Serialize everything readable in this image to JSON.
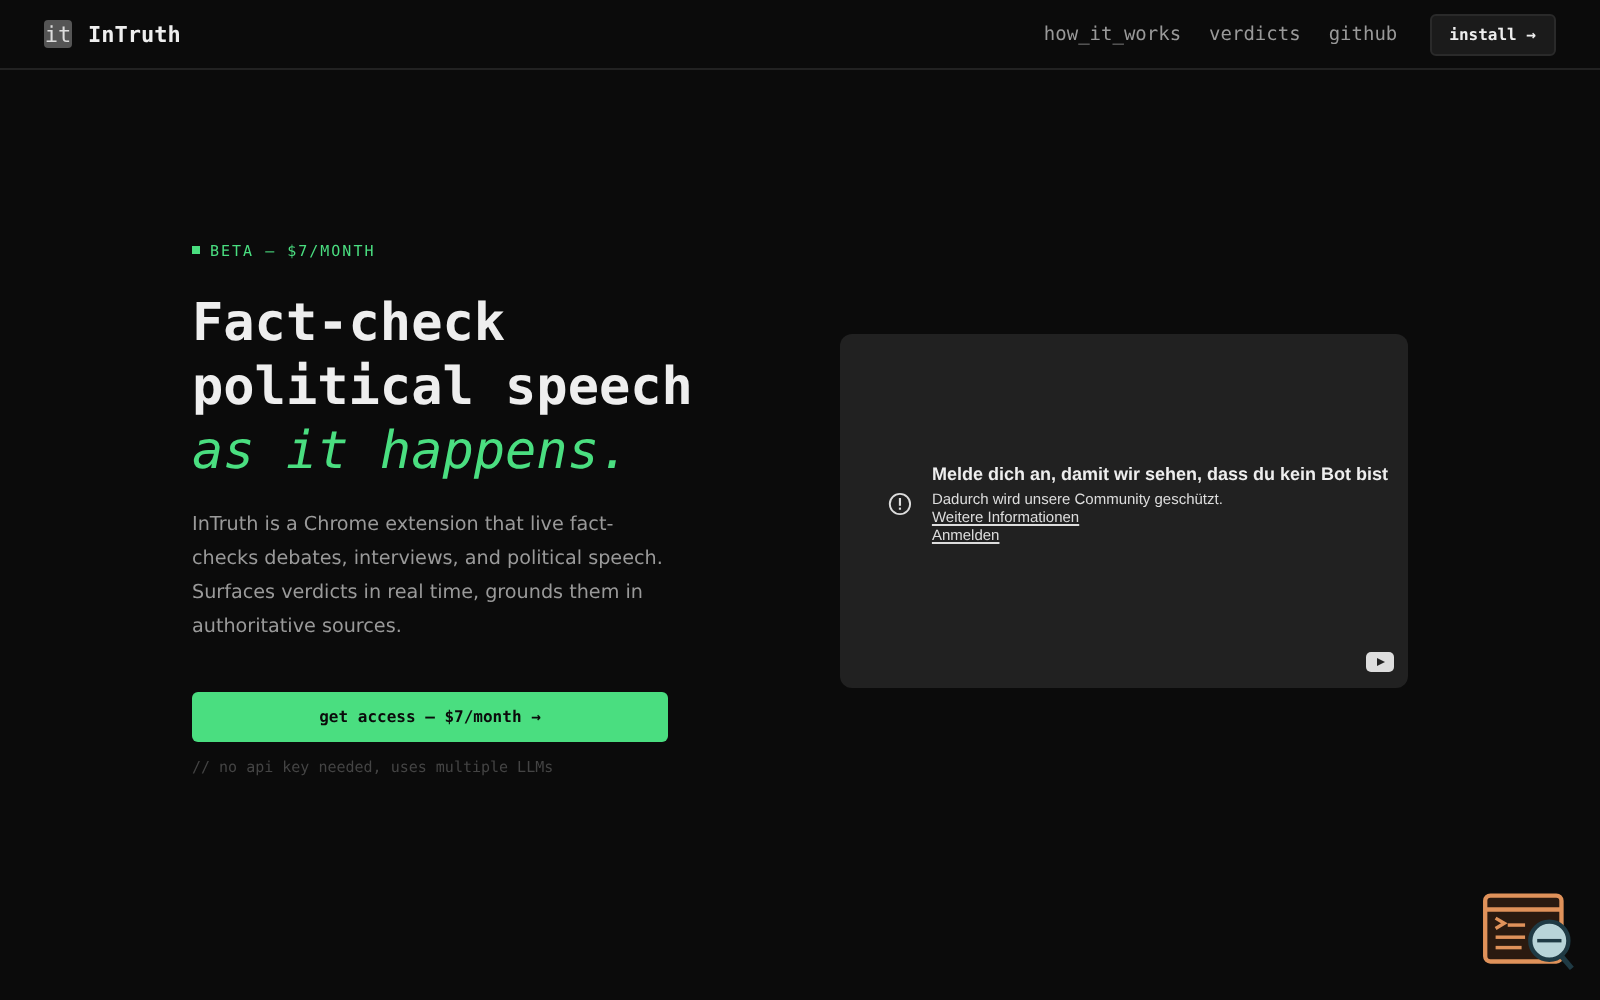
{
  "nav": {
    "logo_mark": "it",
    "brand": "InTruth",
    "links": [
      "how_it_works",
      "verdicts",
      "github"
    ],
    "install": "install →"
  },
  "hero": {
    "badge": "BETA — $7/MONTH",
    "title_lines": [
      "Fact-check",
      "political speech"
    ],
    "title_accent": "as it happens.",
    "description": "InTruth is a Chrome extension that live fact-checks debates, interviews, and political speech. Surfaces verdicts in real time, grounds them in authoritative sources.",
    "cta": "get access — $7/month →",
    "note": "// no api key needed, uses multiple LLMs"
  },
  "video": {
    "heading": "Melde dich an, damit wir sehen, dass du kein Bot bist",
    "text": "Dadurch wird unsere Community geschützt.",
    "more_link": "Weitere Informationen",
    "signin_link": "Anmelden"
  }
}
